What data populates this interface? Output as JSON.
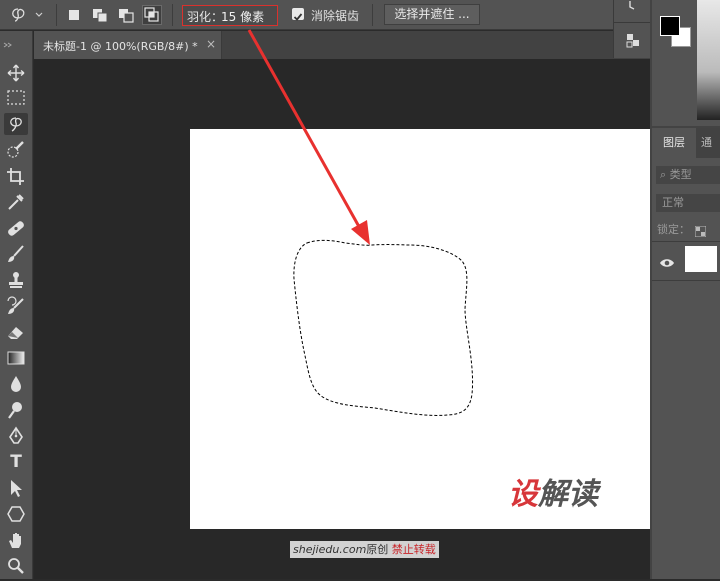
{
  "options_bar": {
    "feather_label": "羽化：",
    "feather_value": "15 像素",
    "antialias_label": "消除锯齿",
    "antialias_checked": true,
    "select_and_mask_label": "选择并遮住 ..."
  },
  "document_tab": {
    "title": "未标题-1 @ 100%(RGB/8#) *",
    "close_glyph": "×"
  },
  "tools": [
    "move-tool",
    "rectangular-marquee-tool",
    "lasso-tool",
    "quick-selection-tool",
    "crop-tool",
    "eyedropper-tool",
    "healing-brush-tool",
    "brush-tool",
    "clone-stamp-tool",
    "history-brush-tool",
    "eraser-tool",
    "gradient-tool",
    "blur-tool",
    "dodge-tool",
    "pen-tool",
    "type-tool",
    "path-selection-tool",
    "shape-tool",
    "hand-tool",
    "zoom-tool"
  ],
  "type_tool_glyph": "T",
  "watermark": {
    "logo_char_1": "设",
    "logo_rest": "解读",
    "credit_site": "shejiedu.com",
    "credit_original": "原创",
    "credit_forbid": "禁止转载"
  },
  "layers_panel": {
    "tab_layers": "图层",
    "tab_channels": "通道",
    "filter_placeholder": "类型",
    "blend_mode": "正常",
    "lock_label": "锁定："
  },
  "colors": {
    "accent_red": "#d9312d",
    "arrow_red": "#e8312f",
    "panel_bg": "#535353",
    "canvas_bg": "#282828"
  }
}
